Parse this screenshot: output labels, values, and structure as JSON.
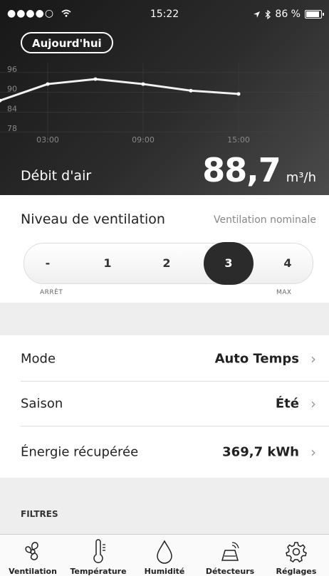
{
  "status_bar": {
    "signal": "●●●●○",
    "time": "15:22",
    "battery": "86 %"
  },
  "header": {
    "period_button": "Aujourd'hui",
    "airflow_label": "Débit d'air",
    "airflow_value": "88,7",
    "airflow_unit": "m³/h"
  },
  "chart_data": {
    "type": "line",
    "y_ticks": [
      "96",
      "90",
      "84",
      "78"
    ],
    "x_ticks": [
      "03:00",
      "09:00",
      "15:00"
    ],
    "x": [
      "00:00",
      "03:00",
      "06:00",
      "09:00",
      "12:00",
      "15:00"
    ],
    "values": [
      87.5,
      92.5,
      94,
      92.5,
      90.5,
      89.5
    ]
  },
  "ventilation": {
    "title": "Niveau de ventilation",
    "status": "Ventilation nominale",
    "levels": [
      "-",
      "1",
      "2",
      "3",
      "4"
    ],
    "selected": "3",
    "min_label": "ARRÊT",
    "max_label": "MAX"
  },
  "rows": [
    {
      "label": "Mode",
      "value": "Auto Temps"
    },
    {
      "label": "Saison",
      "value": "Été"
    },
    {
      "label": "Énergie récupérée",
      "value": "369,7 kWh"
    }
  ],
  "filters_header": "FILTRES",
  "tabs": [
    {
      "label": "Ventilation",
      "icon": "fan-icon"
    },
    {
      "label": "Température",
      "icon": "thermometer-icon"
    },
    {
      "label": "Humidité",
      "icon": "droplet-icon"
    },
    {
      "label": "Détecteurs",
      "icon": "sensor-icon"
    },
    {
      "label": "Réglages",
      "icon": "gear-icon"
    }
  ]
}
